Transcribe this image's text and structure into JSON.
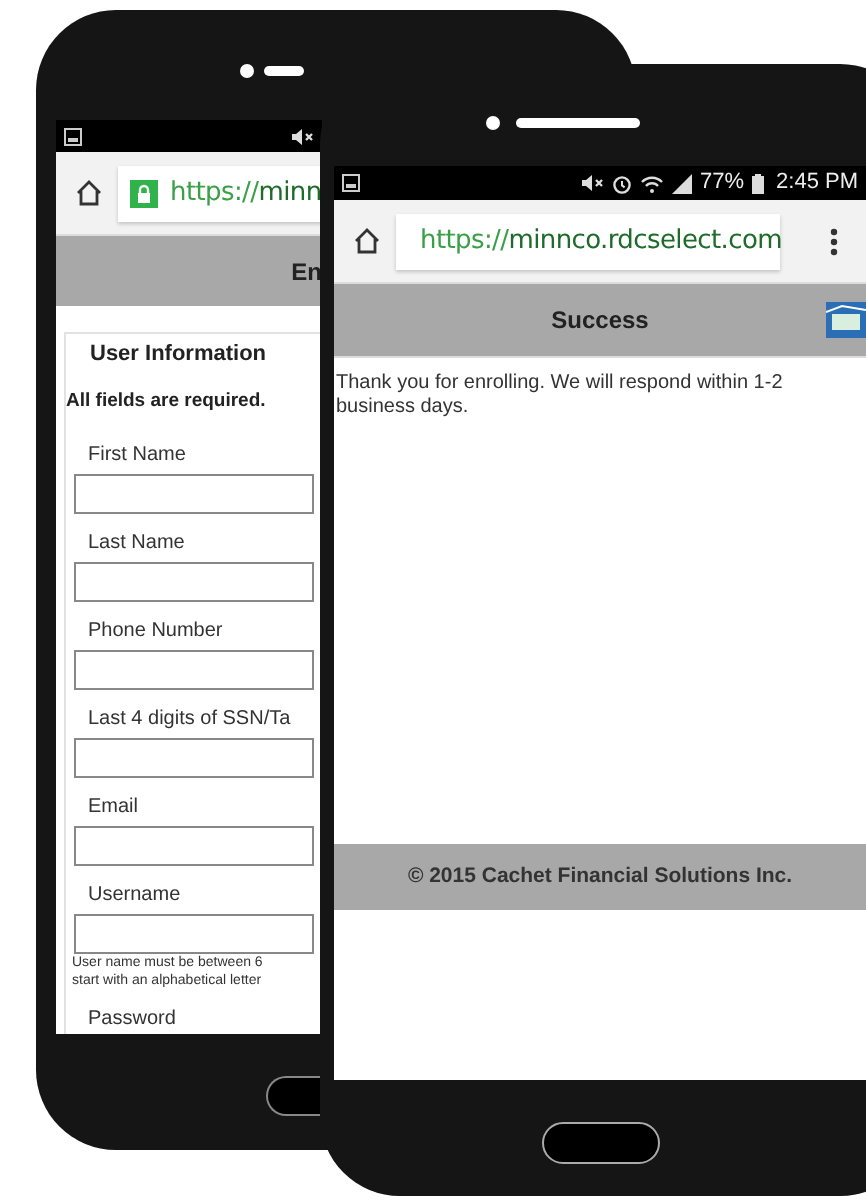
{
  "back_phone": {
    "address_bar": {
      "scheme": "https://",
      "host": "minn"
    },
    "page_title": "En",
    "form": {
      "heading": "User Information",
      "note": "All fields are required.",
      "fields": [
        {
          "kind": "input",
          "label": "First Name"
        },
        {
          "kind": "input",
          "label": "Last Name"
        },
        {
          "kind": "input",
          "label": "Phone Number"
        },
        {
          "kind": "input",
          "label": "Last 4 digits of SSN/Ta"
        },
        {
          "kind": "input",
          "label": "Email"
        },
        {
          "kind": "input",
          "label": "Username",
          "hint_lines": [
            "User name must be between 6",
            "start with an alphabetical letter"
          ]
        },
        {
          "kind": "label",
          "label": "Password"
        }
      ]
    }
  },
  "front_phone": {
    "status_bar": {
      "battery": "77%",
      "time": "2:45 PM"
    },
    "address_bar": {
      "scheme": "https://",
      "host": "minnco.rdcselect.com"
    },
    "page_title": "Success",
    "message": "Thank you for enrolling. We will respond within 1-2 business days.",
    "footer": "© 2015 Cachet Financial Solutions Inc."
  }
}
